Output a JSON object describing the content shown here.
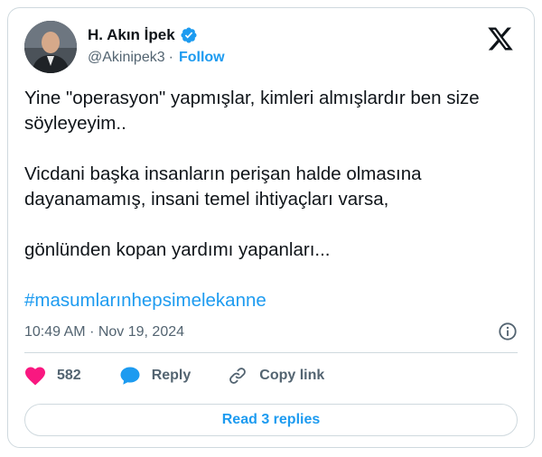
{
  "author": {
    "name": "H. Akın İpek",
    "handle": "@Akinipek3",
    "separator": "·",
    "follow_label": "Follow"
  },
  "tweet": {
    "lines": [
      "Yine \"operasyon\" yapmışlar, kimleri almışlardır ben size söyleyeyim..",
      "Vicdani başka insanların perişan halde olmasına dayanamamış, insani temel ihtiyaçları varsa,",
      "gönlünden kopan yardımı yapanları..."
    ],
    "hashtag": "#masumlarınhepsimelekanne",
    "time": "10:49 AM",
    "date_separator": "·",
    "date": "Nov 19, 2024"
  },
  "actions": {
    "like_count": "582",
    "reply_label": "Reply",
    "copy_label": "Copy link"
  },
  "read_replies_label": "Read 3 replies",
  "colors": {
    "accent": "#1d9bf0",
    "like": "#f91880",
    "text": "#0f1419",
    "muted": "#536471",
    "border": "#cfd9de"
  },
  "icons": {
    "verified": "verified-badge-icon",
    "platform": "x-logo-icon",
    "info": "info-icon",
    "like": "heart-icon",
    "reply": "speech-bubble-icon",
    "copy": "link-icon"
  }
}
